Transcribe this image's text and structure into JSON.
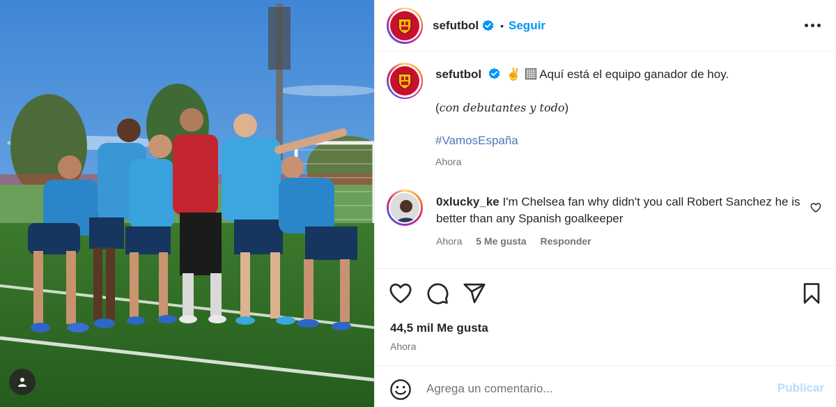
{
  "post": {
    "username": "sefutbol",
    "dot": "•",
    "follow_label": "Seguir",
    "more_label": "Más opciones"
  },
  "caption": {
    "username": "sefutbol",
    "emoji": "✌️",
    "text": "Aquí está el equipo ganador de hoy.",
    "italic_line": "con debutantes y todo",
    "paren_open": "(",
    "paren_close": ")",
    "hashtag": "#VamosEspaña",
    "time": "Ahora"
  },
  "comment": {
    "username": "0xlucky_ke",
    "text": "I'm Chelsea fan why didn't you call Robert Sanchez he is better than any Spanish goalkeeper",
    "time": "Ahora",
    "likes": "5 Me gusta",
    "reply_label": "Responder"
  },
  "actions": {
    "likes_count": "44,5 mil Me gusta",
    "time": "Ahora"
  },
  "add_comment": {
    "placeholder": "Agrega un comentario...",
    "publish_label": "Publicar"
  },
  "colors": {
    "accent_blue": "#0095f6",
    "publish_disabled": "#b2dffc",
    "crest_red": "#c8102e",
    "hashtag": "#4f78b5",
    "muted": "#737373"
  },
  "icons": [
    "verified-badge-icon",
    "more-icon",
    "heart-icon",
    "comment-icon",
    "share-icon",
    "bookmark-icon",
    "emoji-icon",
    "user-tag-icon"
  ]
}
